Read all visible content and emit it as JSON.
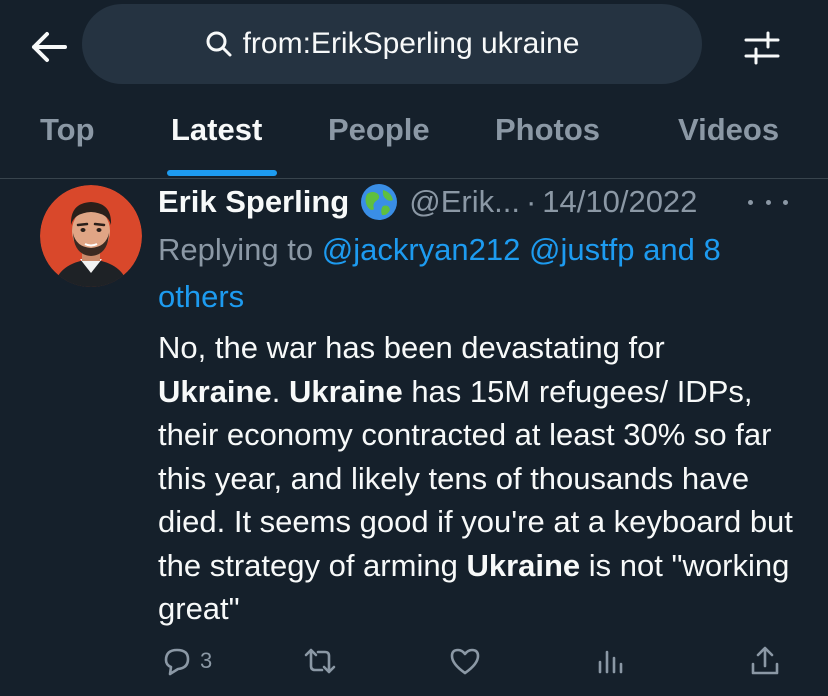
{
  "search": {
    "query": "from:ErikSperling ukraine"
  },
  "tabs": [
    {
      "label": "Top"
    },
    {
      "label": "Latest"
    },
    {
      "label": "People"
    },
    {
      "label": "Photos"
    },
    {
      "label": "Videos"
    }
  ],
  "active_tab": "Latest",
  "tweet": {
    "author_name": "Erik Sperling",
    "author_handle": "@Erik...",
    "separator": "·",
    "date": "14/10/2022",
    "replying_prefix": "Replying to",
    "mention_1": "@jackryan212",
    "mention_2": "@justfp",
    "mention_and": "and 8",
    "mention_others": "others",
    "body": {
      "t1": "No, the war has been devastating for",
      "b1": "Ukraine",
      "t2": ". ",
      "b2": "Ukraine",
      "t3": " has 15M refugees/ IDPs, their economy contracted at least 30% so far this year, and likely tens of thousands have died. It seems good if you're at a keyboard but the strategy of arming ",
      "b3": "Ukraine",
      "t4": " is not \"working great\""
    },
    "reply_count": "3"
  },
  "icons": {
    "back": "arrow-left-icon",
    "search": "search-icon",
    "filter": "sliders-icon",
    "verified": "globe-icon",
    "more": "more-dots-icon",
    "reply": "reply-bubble-icon",
    "retweet": "retweet-icon",
    "like": "heart-icon",
    "views": "bar-chart-icon",
    "share": "share-icon"
  },
  "colors": {
    "background": "#15202b",
    "accent": "#1d9bf0",
    "muted": "#8b98a5",
    "text": "#f7f9f9"
  }
}
